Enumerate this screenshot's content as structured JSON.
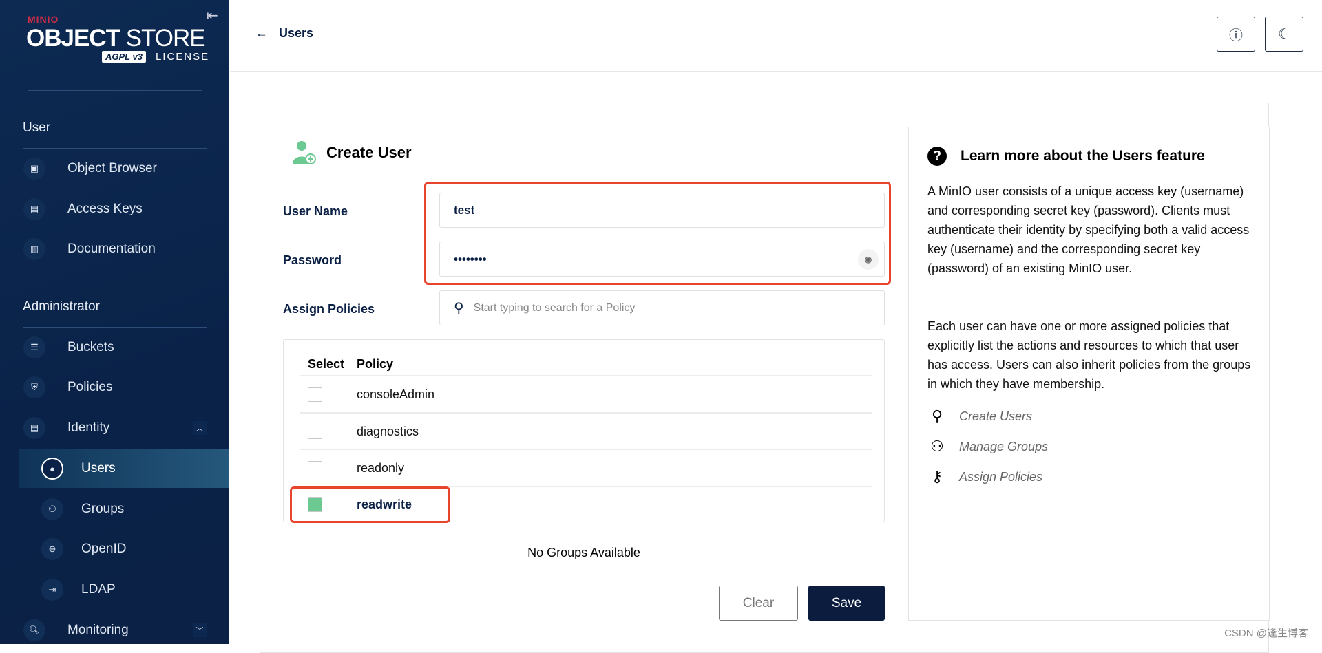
{
  "sidebar": {
    "logo": {
      "brand": "MINIO",
      "product_bold": "OBJECT",
      "product": "STORE",
      "badge": "AGPL v3",
      "license": "LICENSE"
    },
    "collapse_icon": "collapse-left-icon",
    "sections": [
      {
        "title": "User",
        "items": [
          {
            "label": "Object Browser",
            "icon": "object-browser-icon"
          },
          {
            "label": "Access Keys",
            "icon": "access-keys-icon"
          },
          {
            "label": "Documentation",
            "icon": "documentation-icon"
          }
        ]
      },
      {
        "title": "Administrator",
        "items": [
          {
            "label": "Buckets",
            "icon": "bucket-icon"
          },
          {
            "label": "Policies",
            "icon": "shield-icon"
          },
          {
            "label": "Identity",
            "icon": "id-card-icon",
            "expanded": true
          },
          {
            "label": "Users",
            "icon": "user-icon",
            "active": true
          },
          {
            "label": "Groups",
            "icon": "groups-icon"
          },
          {
            "label": "OpenID",
            "icon": "lock-icon"
          },
          {
            "label": "LDAP",
            "icon": "login-icon"
          },
          {
            "label": "Monitoring",
            "icon": "monitoring-icon"
          }
        ]
      }
    ]
  },
  "header": {
    "back_label": "Users",
    "help_icon": "help-icon",
    "theme_icon": "moon-icon"
  },
  "form": {
    "title": "Create User",
    "username_label": "User Name",
    "username_value": "test",
    "password_label": "Password",
    "password_value": "••••••••",
    "policies_label": "Assign Policies",
    "policies_placeholder": "Start typing to search for a Policy",
    "table": {
      "col_select": "Select",
      "col_policy": "Policy",
      "rows": [
        {
          "name": "consoleAdmin",
          "checked": false
        },
        {
          "name": "diagnostics",
          "checked": false
        },
        {
          "name": "readonly",
          "checked": false
        },
        {
          "name": "readwrite",
          "checked": true
        }
      ]
    },
    "no_groups": "No Groups Available",
    "clear_label": "Clear",
    "save_label": "Save"
  },
  "info": {
    "title": "Learn more about the Users feature",
    "para1": "A MinIO user consists of a unique access key (username) and corresponding secret key (password). Clients must authenticate their identity by specifying both a valid access key (username) and the corresponding secret key (password) of an existing MinIO user.",
    "para2": "Each user can have one or more assigned policies that explicitly list the actions and resources to which that user has access. Users can also inherit policies from the groups in which they have membership.",
    "links": [
      "Create Users",
      "Manage Groups",
      "Assign Policies"
    ]
  },
  "watermark": "CSDN @逢生博客",
  "colors": {
    "sidebar": "#0a2248",
    "accent_green": "#6cc991",
    "save_button": "#0c1c3f",
    "highlight_red": "#e8432c"
  }
}
